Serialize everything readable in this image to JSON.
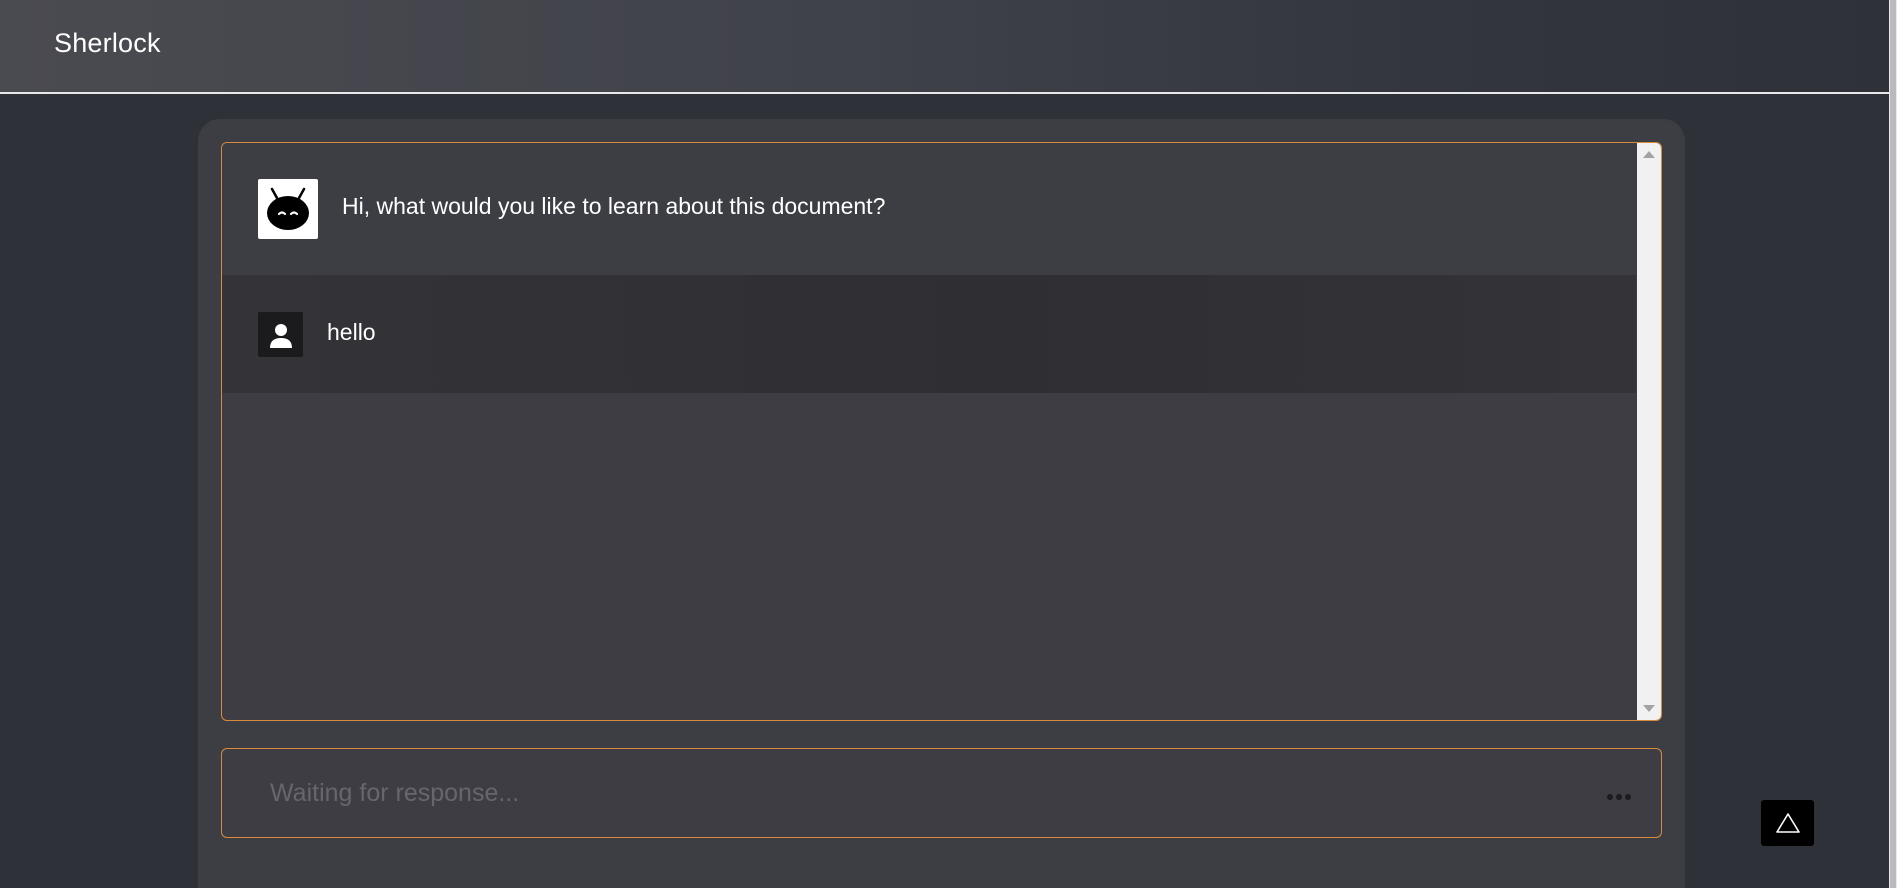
{
  "header": {
    "brand": "Sherlock"
  },
  "chat": {
    "messages": [
      {
        "role": "assistant",
        "text": "Hi, what would you like to learn about this document?",
        "avatar_icon": "robot-icon"
      },
      {
        "role": "user",
        "text": "hello",
        "avatar_icon": "user-icon"
      }
    ]
  },
  "input": {
    "placeholder": "Waiting for response...",
    "value": "",
    "status_icon": "typing-dots-icon"
  },
  "floating_button": {
    "icon": "triangle-icon"
  },
  "colors": {
    "accent": "#d98a3d",
    "background": "#2f3138",
    "card": "#3d3e44",
    "header_border": "#e8e8ea"
  }
}
